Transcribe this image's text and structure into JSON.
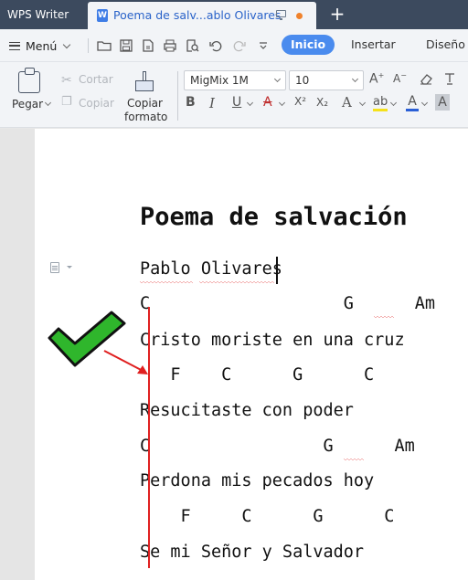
{
  "titlebar": {
    "app_name": "WPS Writer",
    "doc_tab_title": "Poema de salv...ablo Olivares",
    "doc_icon_letter": "W",
    "new_tab_symbol": "+"
  },
  "menubar": {
    "menu_label": "Menú",
    "tabs": [
      {
        "label": "Inicio",
        "active": true
      },
      {
        "label": "Insertar",
        "active": false
      },
      {
        "label": "Diseño",
        "active": false
      }
    ]
  },
  "toolbar": {
    "paste_label": "Pegar",
    "cut_label": "Cortar",
    "copy_label": "Copiar",
    "format_painter_label_1": "Copiar",
    "format_painter_label_2": "formato",
    "font_name": "MigMix 1M",
    "font_size": "10",
    "bold": "B",
    "italic": "I",
    "underline": "U",
    "strike": "A",
    "superscript": "X²",
    "subscript": "X₂",
    "text_effect": "A",
    "highlight": "ab",
    "font_color": "A",
    "char_shading": "A",
    "grow": "A",
    "shrink": "A"
  },
  "document": {
    "title": "Poema de salvación",
    "lines": [
      "Pablo Olivares",
      "C                   G      Am",
      "Cristo moriste en una cruz",
      "   F    C      G      C",
      "Resucitaste con poder",
      "C                 G      Am",
      "Perdona mis pecados hoy",
      "    F     C      G      C",
      "Se mi Señor y Salvador"
    ]
  },
  "colors": {
    "accent": "#4a8bee",
    "titlebar": "#3c4a5e",
    "checkmark": "#2fb62c",
    "annotation_red": "#e02020"
  }
}
